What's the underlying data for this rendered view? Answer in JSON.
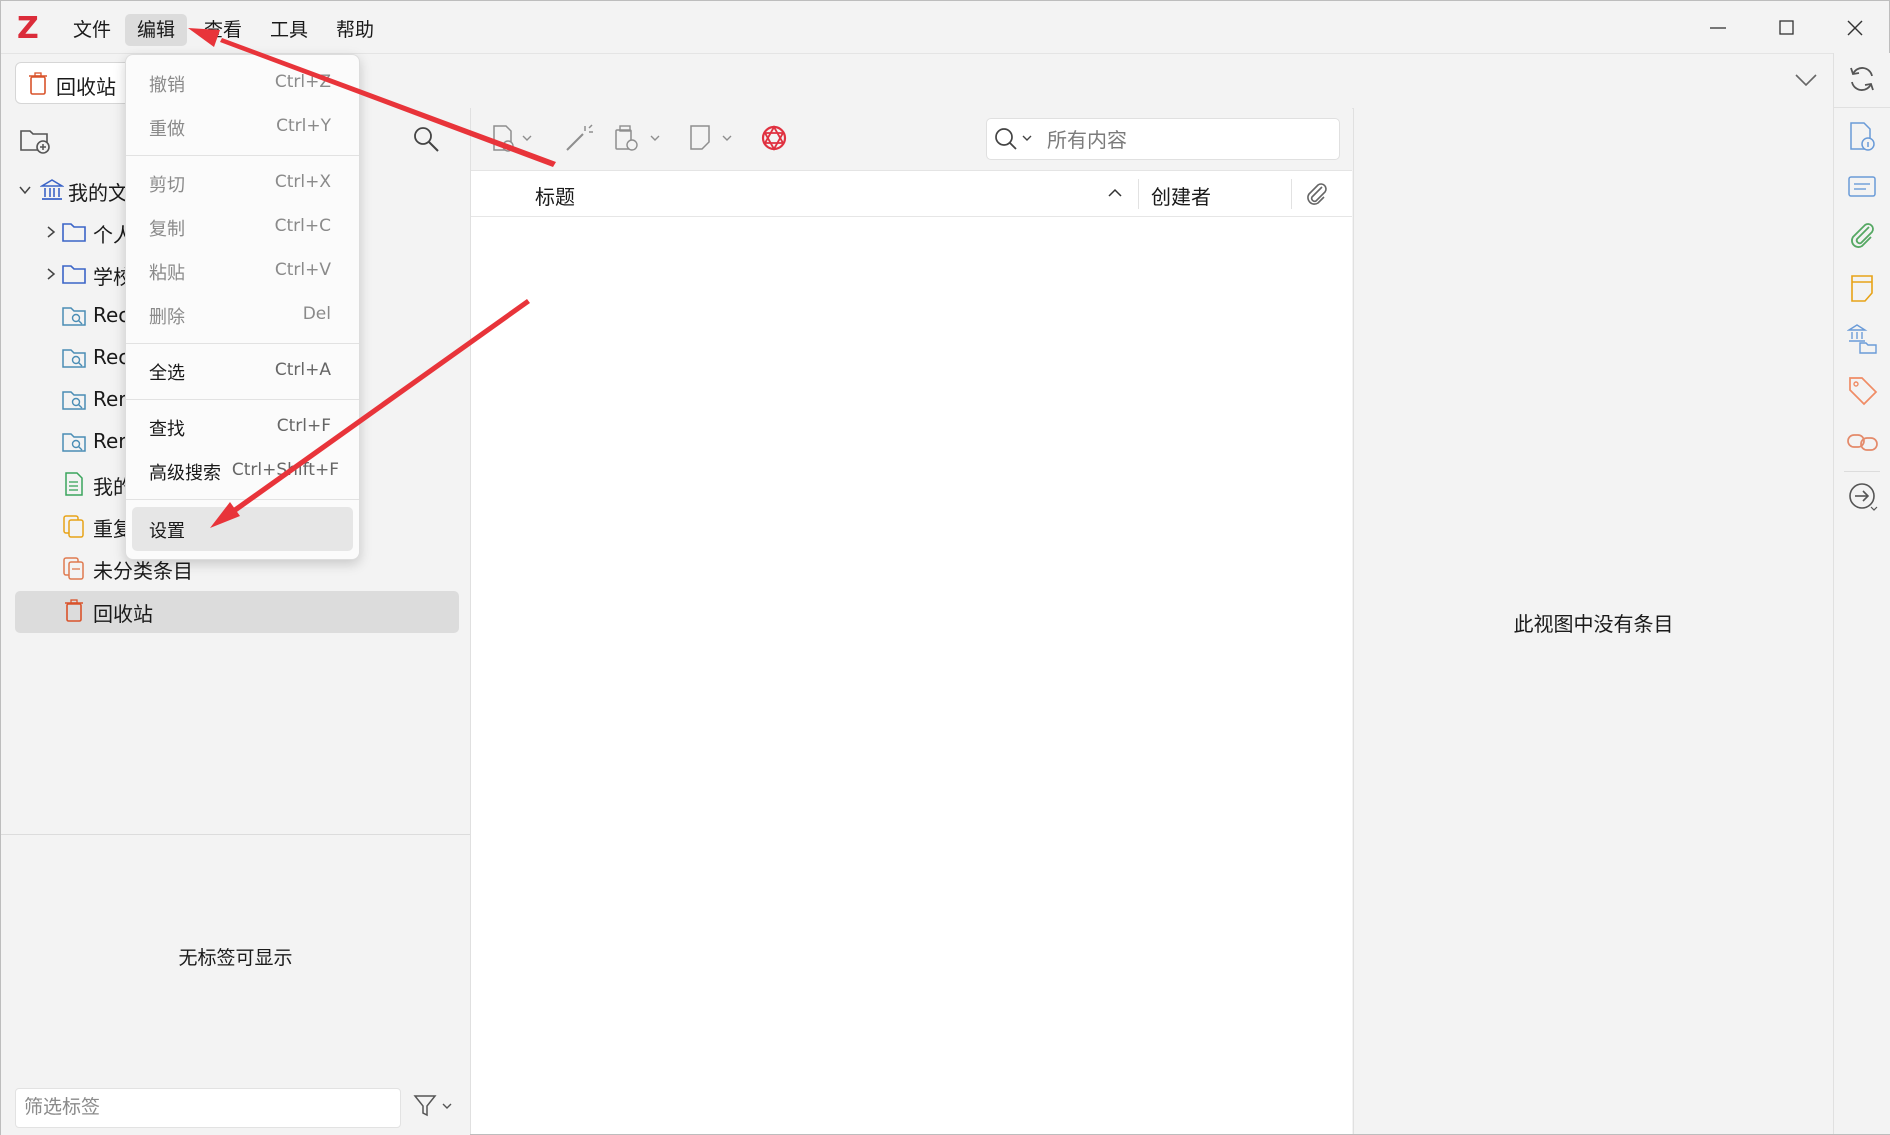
{
  "app": {
    "logo_letter": "Z",
    "menu": [
      "文件",
      "编辑",
      "查看",
      "工具",
      "帮助"
    ],
    "active_menu_index": 1
  },
  "tab": {
    "label": "回收站"
  },
  "collections": {
    "library": "我的文",
    "items": [
      {
        "label": "个人",
        "icon": "folder-icon"
      },
      {
        "label": "学校",
        "icon": "folder-icon"
      },
      {
        "label": "Rec",
        "icon": "saved-search-icon"
      },
      {
        "label": "Rec",
        "icon": "saved-search-icon"
      },
      {
        "label": "Ren",
        "icon": "saved-search-icon"
      },
      {
        "label": "Ren",
        "icon": "saved-search-icon"
      },
      {
        "label": "我的",
        "icon": "document-icon"
      },
      {
        "label": "重复",
        "icon": "duplicate-icon"
      },
      {
        "label": "未分类条目",
        "icon": "unfiled-icon"
      },
      {
        "label": "回收站",
        "icon": "trash-icon"
      }
    ]
  },
  "tags": {
    "empty_message": "无标签可显示",
    "filter_placeholder": "筛选标签"
  },
  "items_pane": {
    "search_placeholder": "所有内容",
    "columns": {
      "title": "标题",
      "creator": "创建者"
    }
  },
  "item_pane": {
    "empty_message": "此视图中没有条目"
  },
  "edit_menu": {
    "items": [
      {
        "label": "撤销",
        "shortcut": "Ctrl+Z",
        "enabled": false
      },
      {
        "label": "重做",
        "shortcut": "Ctrl+Y",
        "enabled": false
      },
      {
        "label": "剪切",
        "shortcut": "Ctrl+X",
        "enabled": false
      },
      {
        "label": "复制",
        "shortcut": "Ctrl+C",
        "enabled": false
      },
      {
        "label": "粘贴",
        "shortcut": "Ctrl+V",
        "enabled": false
      },
      {
        "label": "删除",
        "shortcut": "Del",
        "enabled": false
      },
      {
        "label": "全选",
        "shortcut": "Ctrl+A",
        "enabled": true
      },
      {
        "label": "查找",
        "shortcut": "Ctrl+F",
        "enabled": true
      },
      {
        "label": "高级搜索",
        "shortcut": "Ctrl+Shift+F",
        "enabled": true
      },
      {
        "label": "设置",
        "shortcut": "",
        "enabled": true
      }
    ],
    "highlighted_item": "设置"
  },
  "colors": {
    "logo": "#db2c3a",
    "annotation_arrow": "#e8343a",
    "library_icon": "#3b64c8",
    "folder_icon": "#3b64c8",
    "trash_icon": "#d9532b",
    "sync_icon": "#555555"
  }
}
